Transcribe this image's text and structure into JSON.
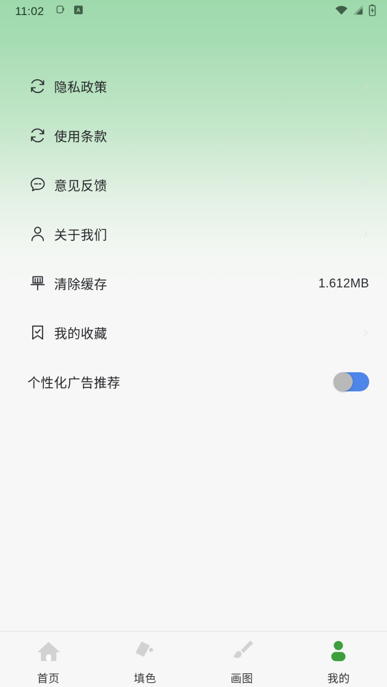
{
  "status_bar": {
    "time": "11:02",
    "left_icons": [
      "clipboard-icon",
      "app-badge-a-icon"
    ],
    "right_icons": [
      "wifi-icon",
      "cellular-signal-icon",
      "battery-charging-icon"
    ]
  },
  "settings": {
    "rows": [
      {
        "icon": "sync-circle-icon",
        "label": "隐私政策",
        "value": "",
        "accessory": "chevron-right-icon"
      },
      {
        "icon": "sync-circle-icon",
        "label": "使用条款",
        "value": "",
        "accessory": "chevron-right-icon"
      },
      {
        "icon": "speech-bubble-icon",
        "label": "意见反馈",
        "value": "",
        "accessory": "chevron-right-icon"
      },
      {
        "icon": "person-icon",
        "label": "关于我们",
        "value": "",
        "accessory": "chevron-right-icon"
      },
      {
        "icon": "broom-icon",
        "label": "清除缓存",
        "value": "1.612MB",
        "accessory": ""
      },
      {
        "icon": "bookmark-check-icon",
        "label": "我的收藏",
        "value": "",
        "accessory": "chevron-right-icon"
      }
    ],
    "ad_toggle": {
      "label": "个性化广告推荐",
      "state": "off",
      "track_color": "#4d85e8",
      "knob_color": "#b9b9b9"
    }
  },
  "tabbar": {
    "active_color": "#3d9e3d",
    "inactive_color": "#d2d2d2",
    "items": [
      {
        "icon": "home-icon",
        "label": "首页",
        "active": false
      },
      {
        "icon": "paint-bucket-icon",
        "label": "填色",
        "active": false
      },
      {
        "icon": "paintbrush-icon",
        "label": "画图",
        "active": false
      },
      {
        "icon": "person-filled-icon",
        "label": "我的",
        "active": true
      }
    ]
  },
  "theme": {
    "gradient_top": "#9ed9ac",
    "gradient_bottom": "#f7f7f7",
    "page_background": "#f7f7f7",
    "text_primary": "#25262a"
  }
}
